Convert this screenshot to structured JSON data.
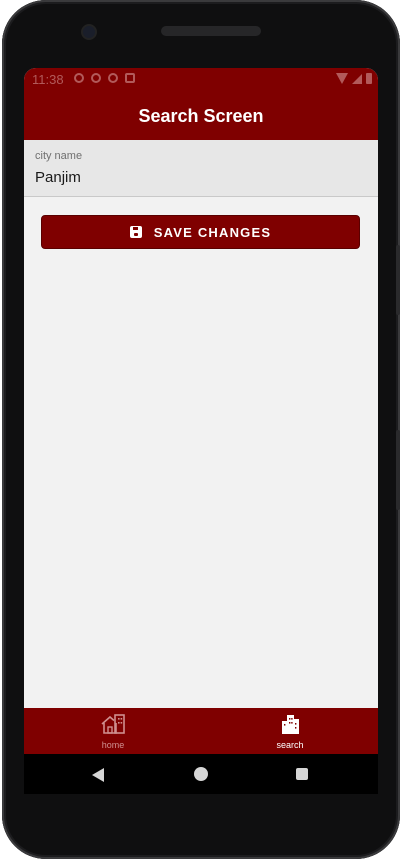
{
  "status_bar": {
    "time": "11:38"
  },
  "app_bar": {
    "title": "Search Screen"
  },
  "form": {
    "city_label": "city name",
    "city_value": "Panjim"
  },
  "save_button": {
    "label": "SAVE CHANGES",
    "icon": "floppy-disk-icon"
  },
  "bottom_nav": {
    "items": [
      {
        "label": "home",
        "icon": "home-icon",
        "active": false
      },
      {
        "label": "search",
        "icon": "city-icon",
        "active": true
      }
    ]
  },
  "colors": {
    "primary": "#7f0000",
    "background": "#f2f2f2",
    "field_bg": "#e7e7e7",
    "inactive_nav": "#cf8f8f",
    "active_nav": "#ffffff"
  }
}
